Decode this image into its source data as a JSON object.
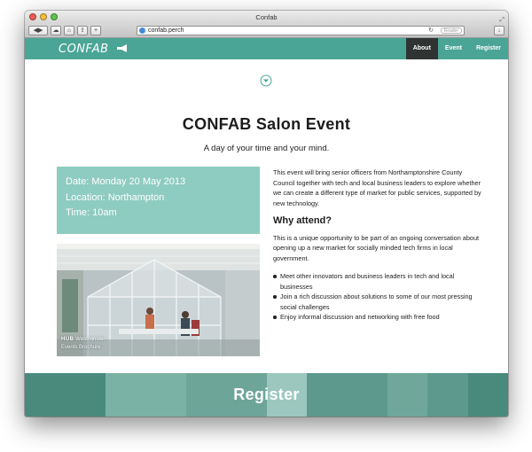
{
  "window": {
    "title": "Confab"
  },
  "toolbar": {
    "url": "confab.perch",
    "reader_label": "Reader"
  },
  "site": {
    "logo": "CONFAB",
    "nav": [
      {
        "label": "About",
        "active": true
      },
      {
        "label": "Event",
        "active": false
      },
      {
        "label": "Register",
        "active": false
      }
    ]
  },
  "page": {
    "title": "CONFAB Salon Event",
    "subtitle": "A day of your time and your mind.",
    "details": {
      "date": "Date: Monday 20 May 2013",
      "location": "Location: Northampton",
      "time": "Time: 10am"
    },
    "photo_caption": {
      "hub": "HUB",
      "hub_suffix": "Westminster",
      "line2": "Events Brochure"
    },
    "intro": "This event will bring senior officers from Northamptonshire County Council together with tech and local business leaders to explore whether we can create a different type of market for public services, supported by new technology.",
    "why_heading": "Why attend?",
    "why_text": "This is a unique opportunity to be part of an ongoing conversation about opening up a new market for socially minded tech firms in local government.",
    "bullets": [
      "Meet other innovators and business leaders in tech and local businesses",
      "Join a rich discussion about solutions to some of our most pressing social challenges",
      "Enjoy informal discussion and networking with free food"
    ],
    "register_label": "Register"
  },
  "colors": {
    "brand": "#4aa596",
    "info_box": "#8ecbc0",
    "nav_active": "#2f3432",
    "register_tiles": [
      "#4a8a7d",
      "#4a8a7d",
      "#7ab2a6",
      "#7ab2a6",
      "#6ea599",
      "#6ea599",
      "#9bc7bf",
      "#5d998d",
      "#5d998d",
      "#6fa89b",
      "#5d998d",
      "#4a8a7d"
    ]
  }
}
